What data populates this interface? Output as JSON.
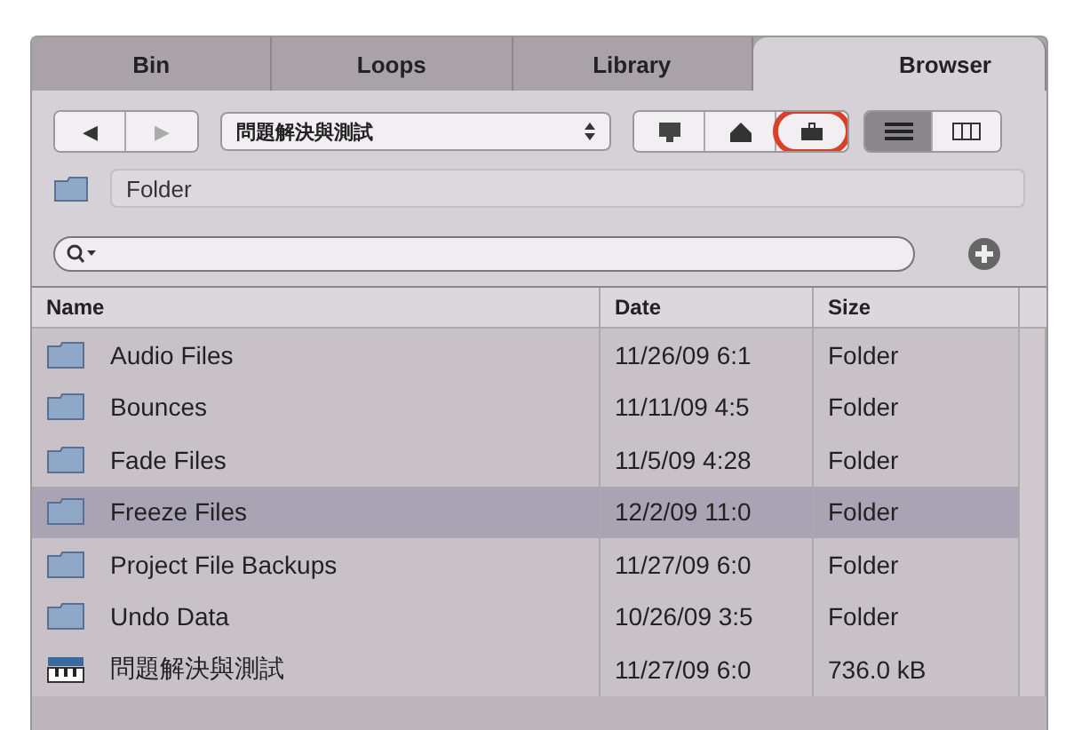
{
  "tabs": [
    {
      "label": "Bin",
      "selected": false
    },
    {
      "label": "Loops",
      "selected": false
    },
    {
      "label": "Library",
      "selected": false
    },
    {
      "label": "Browser",
      "selected": true
    }
  ],
  "toolbar": {
    "nav": [
      {
        "label": "◀",
        "disabled": false
      },
      {
        "label": "▶",
        "disabled": true
      }
    ],
    "location": "問題解決與測試",
    "places": [
      {
        "kind": "computer",
        "highlighted": false
      },
      {
        "kind": "home",
        "highlighted": false
      },
      {
        "kind": "project",
        "highlighted": true
      }
    ],
    "views": [
      {
        "kind": "list",
        "selected": true
      },
      {
        "kind": "columns",
        "selected": false
      }
    ]
  },
  "path": {
    "value": "Folder"
  },
  "table": {
    "columns": [
      "Name",
      "Date",
      "Size"
    ],
    "rows": [
      {
        "kind": "folder",
        "name": "Audio Files",
        "date": "11/26/09 6:1",
        "size": "Folder",
        "selected": false
      },
      {
        "kind": "folder",
        "name": "Bounces",
        "date": "11/11/09 4:5",
        "size": "Folder",
        "selected": false
      },
      {
        "kind": "folder",
        "name": "Fade Files",
        "date": "11/5/09 4:28",
        "size": "Folder",
        "selected": false
      },
      {
        "kind": "folder",
        "name": "Freeze Files",
        "date": "12/2/09 11:0",
        "size": "Folder",
        "selected": true
      },
      {
        "kind": "folder",
        "name": "Project File Backups",
        "date": "11/27/09 6:0",
        "size": "Folder",
        "selected": false
      },
      {
        "kind": "folder",
        "name": "Undo Data",
        "date": "10/26/09 3:5",
        "size": "Folder",
        "selected": false
      },
      {
        "kind": "project",
        "name": "問題解決與測試",
        "date": "11/27/09 6:0",
        "size": "736.0 kB",
        "selected": false
      }
    ]
  }
}
